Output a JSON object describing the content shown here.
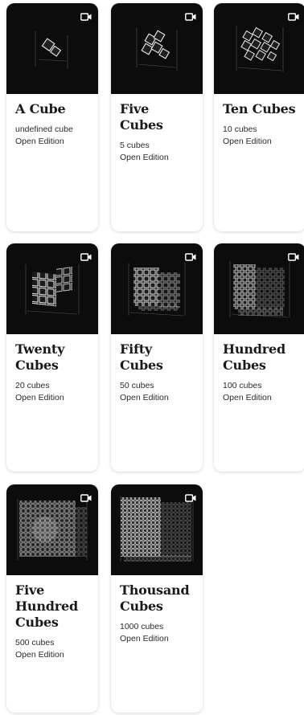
{
  "cards": [
    {
      "title": "A Cube",
      "count": "undefined cube",
      "edition": "Open Edition",
      "thumbnail": "cube-art-1",
      "icon": "video-icon"
    },
    {
      "title": "Five Cubes",
      "count": "5 cubes",
      "edition": "Open Edition",
      "thumbnail": "cube-art-5",
      "icon": "video-icon"
    },
    {
      "title": "Ten Cubes",
      "count": "10 cubes",
      "edition": "Open Edition",
      "thumbnail": "cube-art-10",
      "icon": "video-icon"
    },
    {
      "title": "Twenty Cubes",
      "count": "20 cubes",
      "edition": "Open Edition",
      "thumbnail": "cube-art-20",
      "icon": "video-icon"
    },
    {
      "title": "Fifty Cubes",
      "count": "50 cubes",
      "edition": "Open Edition",
      "thumbnail": "cube-art-50",
      "icon": "video-icon"
    },
    {
      "title": "Hundred Cubes",
      "count": "100 cubes",
      "edition": "Open Edition",
      "thumbnail": "cube-art-100",
      "icon": "video-icon"
    },
    {
      "title": "Five Hundred Cubes",
      "count": "500 cubes",
      "edition": "Open Edition",
      "thumbnail": "cube-art-500",
      "icon": "video-icon"
    },
    {
      "title": "Thousand Cubes",
      "count": "1000 cubes",
      "edition": "Open Edition",
      "thumbnail": "cube-art-1000",
      "icon": "video-icon"
    }
  ]
}
